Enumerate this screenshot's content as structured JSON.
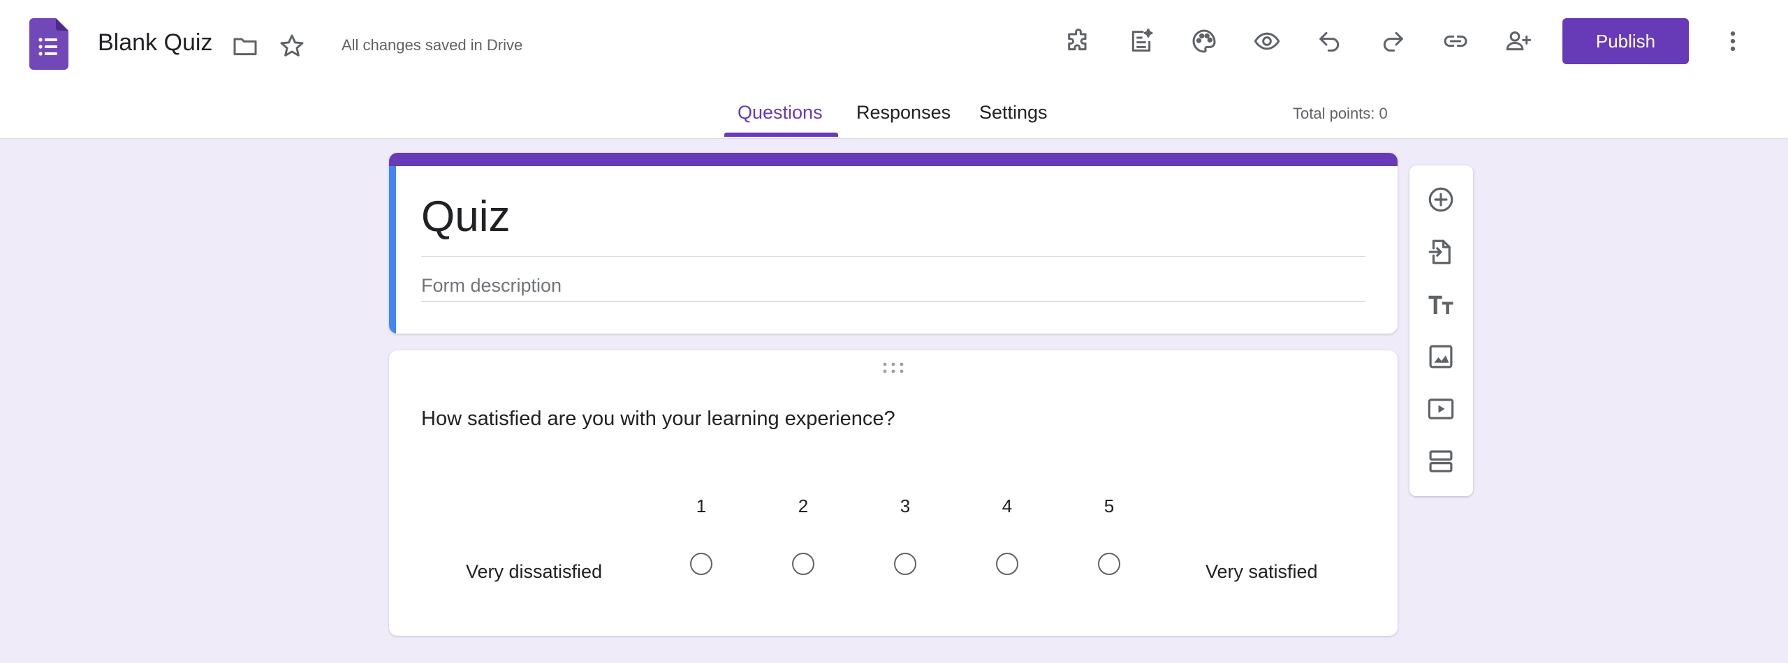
{
  "header": {
    "doc_title": "Blank Quiz",
    "save_status": "All changes saved in Drive",
    "publish_label": "Publish",
    "icons": [
      "forms-logo-icon",
      "folder-icon",
      "star-icon",
      "addons-icon",
      "ai-magic-icon",
      "palette-icon",
      "preview-eye-icon",
      "undo-icon",
      "redo-icon",
      "link-icon",
      "add-collaborator-icon",
      "more-vert-icon"
    ]
  },
  "tabs": [
    {
      "label": "Questions",
      "active": true
    },
    {
      "label": "Responses",
      "active": false
    },
    {
      "label": "Settings",
      "active": false
    }
  ],
  "total_points": "Total points: 0",
  "form": {
    "title": "Quiz",
    "description_placeholder": "Form description"
  },
  "question": {
    "text": "How satisfied are you with your learning experience?",
    "scale": [
      "1",
      "2",
      "3",
      "4",
      "5"
    ],
    "low_label": "Very dissatisfied",
    "high_label": "Very satisfied"
  },
  "toolbar": {
    "icons": [
      "add-question-icon",
      "import-questions-icon",
      "add-title-icon",
      "add-image-icon",
      "add-video-icon",
      "add-section-icon"
    ]
  },
  "colors": {
    "accent": "#673ab7",
    "background": "#f0ebf8",
    "title_left_bar": "#4285f4"
  }
}
